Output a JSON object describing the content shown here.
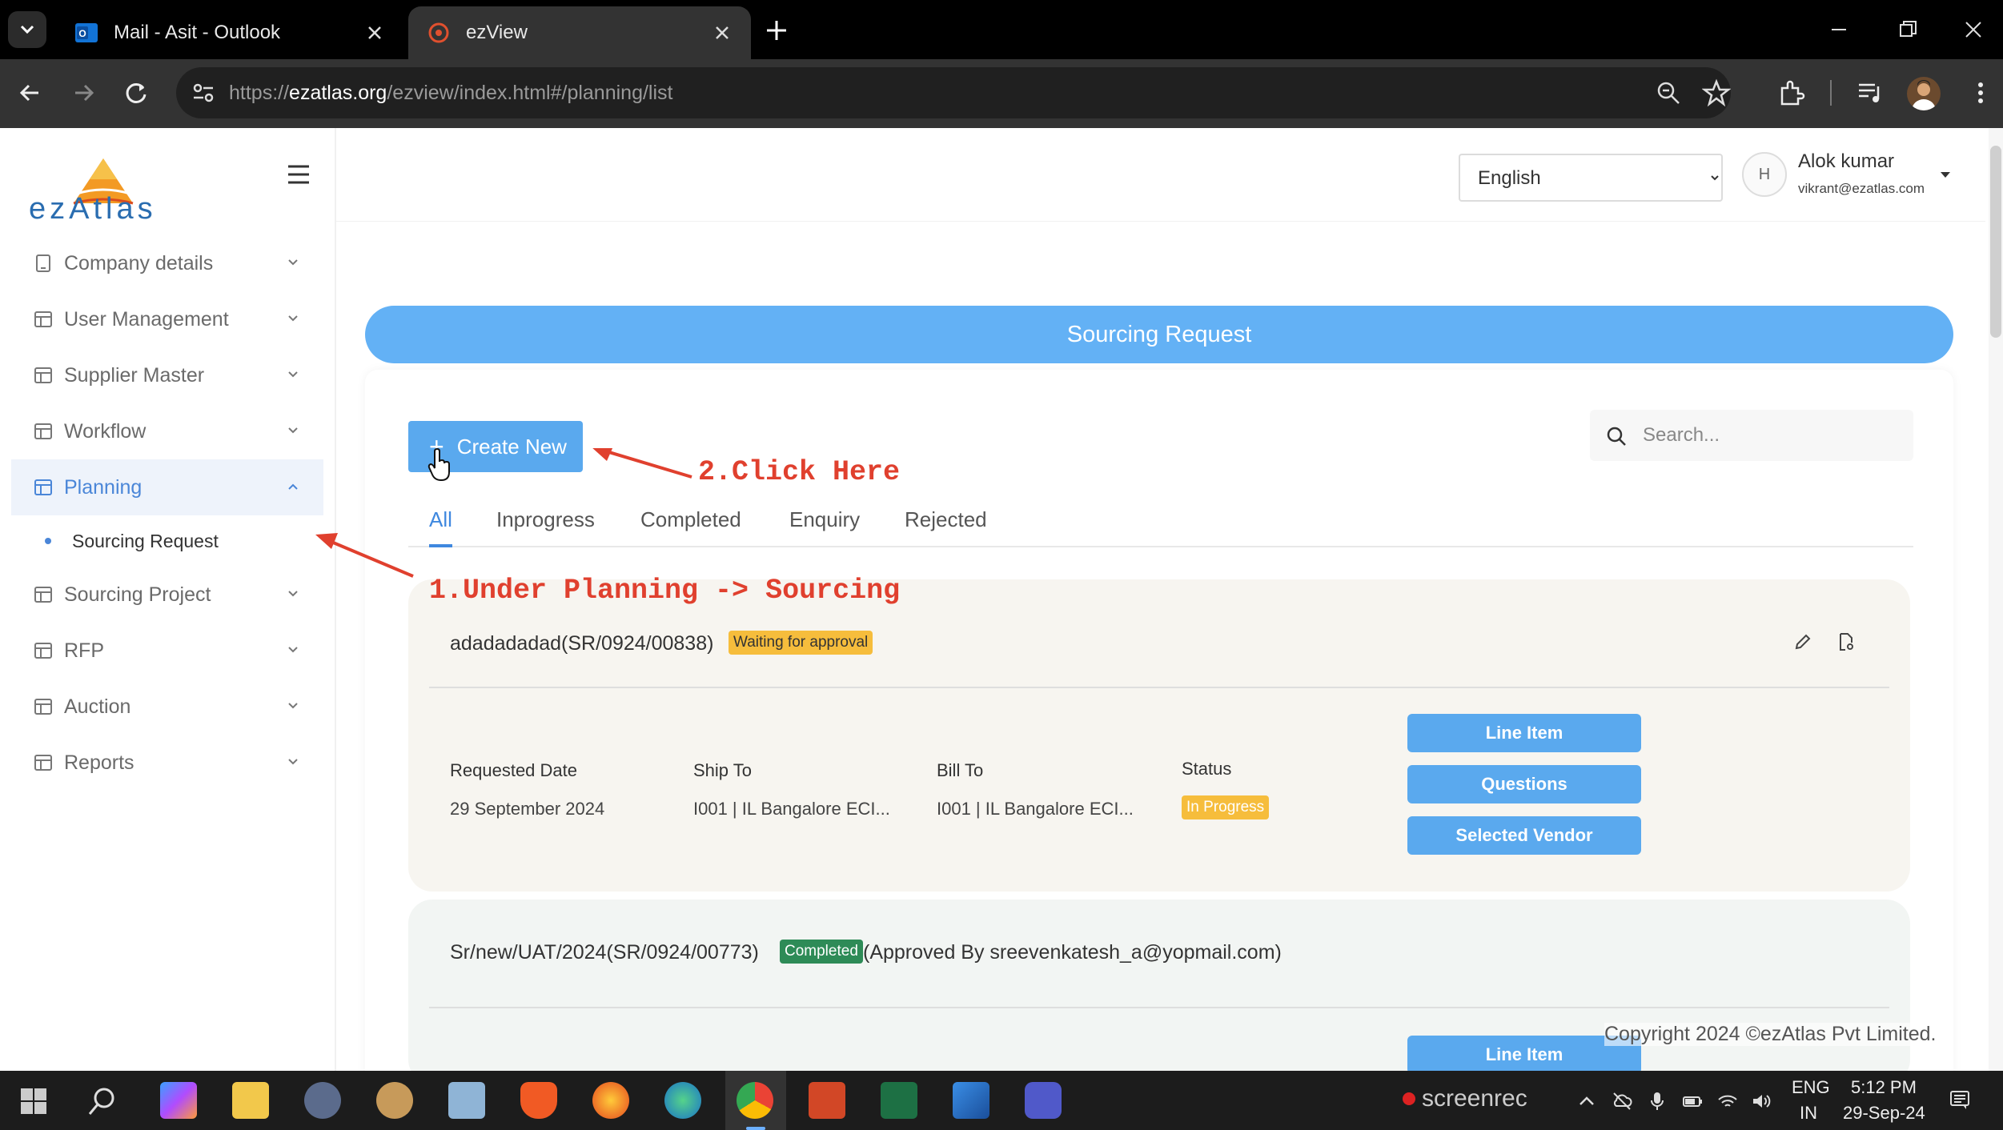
{
  "browser": {
    "tabs": [
      {
        "title": "Mail - Asit - Outlook",
        "active": false
      },
      {
        "title": "ezView",
        "active": true
      }
    ],
    "url_prefix": "https://",
    "url_host": "ezatlas.org",
    "url_path": "/ezview/index.html#/planning/list"
  },
  "app": {
    "logo_text": "ezAtlas",
    "language": "English",
    "language_options": [
      "English"
    ],
    "user": {
      "avatar_alt": "H",
      "name": "Alok kumar",
      "email": "vikrant@ezatlas.com"
    }
  },
  "sidebar": {
    "items": [
      {
        "label": "Company details"
      },
      {
        "label": "User Management"
      },
      {
        "label": "Supplier Master"
      },
      {
        "label": "Workflow"
      },
      {
        "label": "Planning",
        "expanded": true
      },
      {
        "label": "Sourcing Project"
      },
      {
        "label": "RFP"
      },
      {
        "label": "Auction"
      },
      {
        "label": "Reports"
      }
    ],
    "sub_items": [
      {
        "label": "Sourcing Request"
      }
    ]
  },
  "main": {
    "banner_title": "Sourcing Request",
    "create_label": "Create New",
    "search_placeholder": "Search...",
    "tabs": [
      "All",
      "Inprogress",
      "Completed",
      "Enquiry",
      "Rejected"
    ],
    "active_tab": "All",
    "records": [
      {
        "title": "adadadadad(SR/0924/00838)",
        "badge": "Waiting for approval",
        "fields": {
          "requested_date_label": "Requested Date",
          "requested_date": "29 September 2024",
          "ship_to_label": "Ship To",
          "ship_to": "I001 | IL Bangalore ECI...",
          "bill_to_label": "Bill To",
          "bill_to": "I001 | IL Bangalore ECI...",
          "status_label": "Status",
          "status": "In Progress"
        },
        "actions": [
          "Line Item",
          "Questions",
          "Selected Vendor"
        ]
      },
      {
        "title": "Sr/new/UAT/2024(SR/0924/00773)",
        "badge": "Completed",
        "approved_by": "(Approved By sreevenkatesh_a@yopmail.com)",
        "actions": [
          "Line Item"
        ]
      }
    ]
  },
  "annotations": {
    "step1": "1.Under Planning -> Sourcing",
    "step2": "2.Click Here",
    "color": "#e0402e"
  },
  "footer": {
    "copyright": "Copyright 2024 ©ezAtlas Pvt Limited."
  },
  "taskbar": {
    "recorder": "screenrec",
    "lang_top": "ENG",
    "lang_bottom": "IN",
    "time": "5:12 PM",
    "date": "29-Sep-24"
  },
  "colors": {
    "accent": "#63b1f5",
    "badge_waiting": "#f6bd3c",
    "badge_completed": "#2e8b57"
  }
}
